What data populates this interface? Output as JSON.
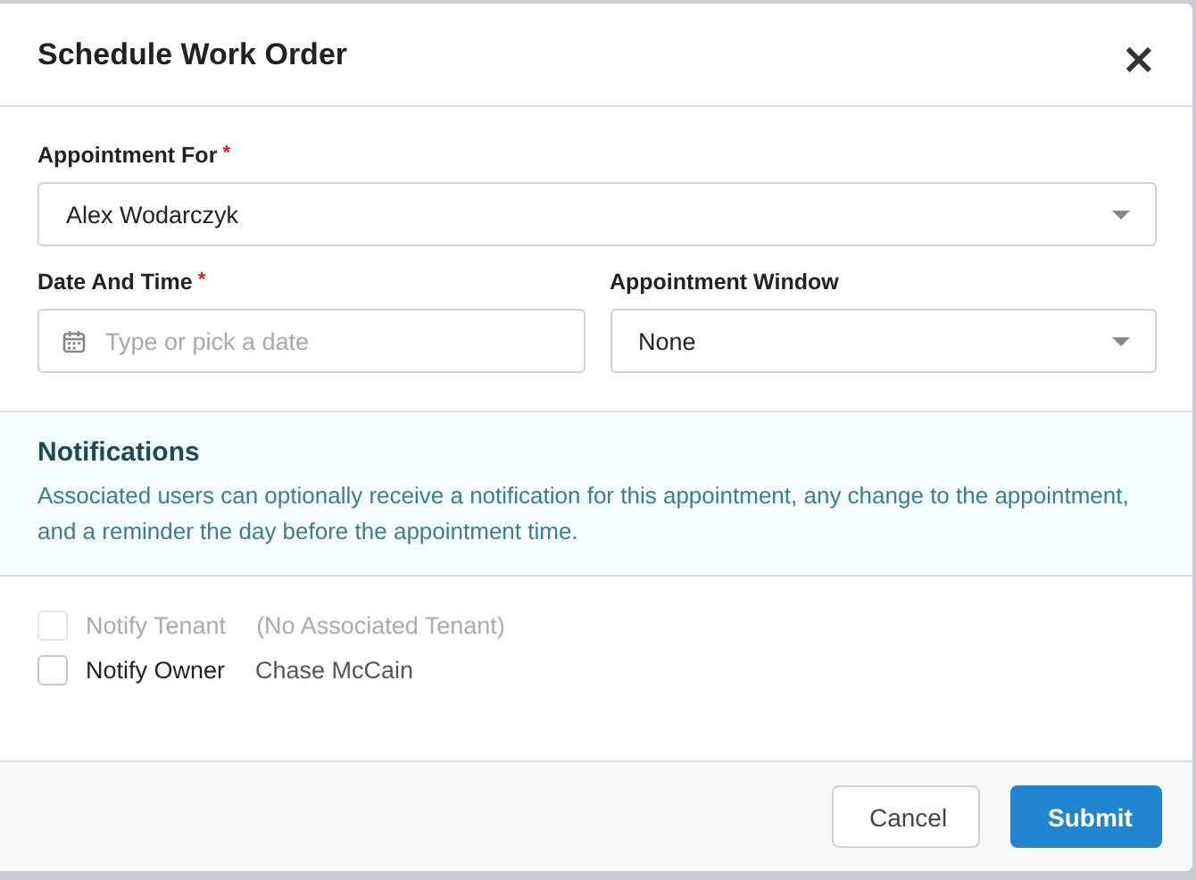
{
  "dialog": {
    "title": "Schedule Work Order",
    "close": "×"
  },
  "field_rows": [
    [
      {
        "kind": "select",
        "label": "Appointment For",
        "required_mark": "*",
        "value": "Alex Wodarczyk"
      }
    ],
    [
      {
        "kind": "date",
        "label": "Date And Time",
        "required_mark": "*",
        "placeholder": "Type or pick a date"
      },
      {
        "kind": "select",
        "label": "Appointment Window",
        "value": "None"
      }
    ]
  ],
  "notifications": {
    "title": "Notifications",
    "text": "Associated users can optionally receive a notification for this appointment, any change to the appointment, and a reminder the day before the appointment time."
  },
  "options": [
    {
      "label": "Notify Tenant",
      "detail": "(No Associated Tenant)",
      "checked": false,
      "disabled": true
    },
    {
      "label": "Notify Owner",
      "detail": "Chase McCain",
      "checked": false,
      "disabled": false
    }
  ],
  "buttons": [
    {
      "label": "Cancel",
      "kind": "secondary"
    },
    {
      "label": "Submit",
      "kind": "primary"
    }
  ]
}
